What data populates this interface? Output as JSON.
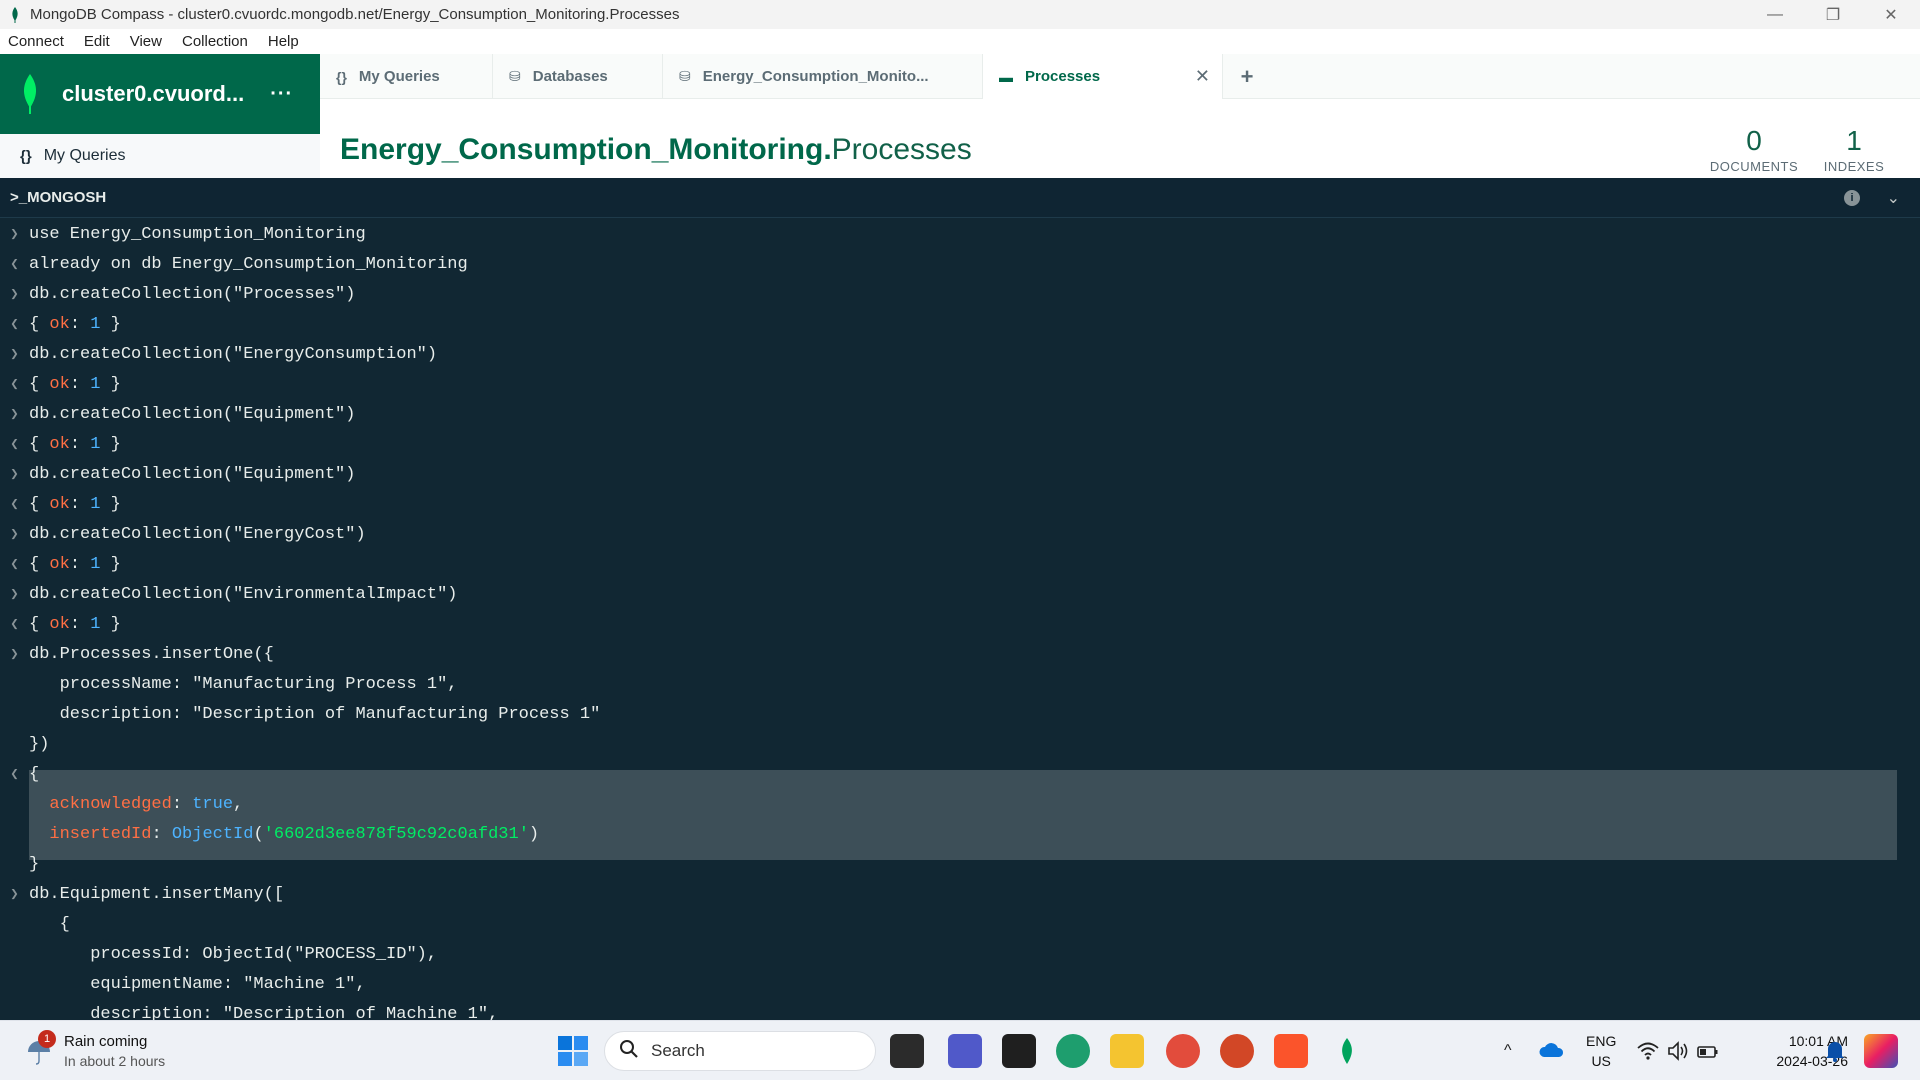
{
  "window": {
    "title": "MongoDB Compass - cluster0.cvuordc.mongodb.net/Energy_Consumption_Monitoring.Processes",
    "minimize": "—",
    "restore": "❐",
    "close": "✕"
  },
  "menu": [
    "Connect",
    "Edit",
    "View",
    "Collection",
    "Help"
  ],
  "sidebar": {
    "cluster_name": "cluster0.cvuord...",
    "more": "···",
    "my_queries": "My Queries",
    "my_queries_icon": "{}"
  },
  "tabs": [
    {
      "label": "My Queries",
      "icon": "{}"
    },
    {
      "label": "Databases",
      "icon": "⛁"
    },
    {
      "label": "Energy_Consumption_Monito...",
      "icon": "⛁"
    },
    {
      "label": "Processes",
      "icon": "▬",
      "close": "✕"
    }
  ],
  "tab_add": "+",
  "collection": {
    "db": "Energy_Consumption_Monitoring.",
    "name": "Processes",
    "documents_count": "0",
    "documents_label": "DOCUMENTS",
    "indexes_count": "1",
    "indexes_label": "INDEXES"
  },
  "shell": {
    "title": ">_MONGOSH",
    "info": "i",
    "chevron": "⌄",
    "lines": [
      {
        "dir": ">",
        "text": "use Energy_Consumption_Monitoring"
      },
      {
        "dir": "<",
        "text": "already on db Energy_Consumption_Monitoring"
      },
      {
        "dir": ">",
        "text": "db.createCollection(\"Processes\")"
      },
      {
        "dir": "<",
        "text": "{ ok: 1 }"
      },
      {
        "dir": ">",
        "text": "db.createCollection(\"EnergyConsumption\")"
      },
      {
        "dir": "<",
        "text": "{ ok: 1 }"
      },
      {
        "dir": ">",
        "text": "db.createCollection(\"Equipment\")"
      },
      {
        "dir": "<",
        "text": "{ ok: 1 }"
      },
      {
        "dir": ">",
        "text": "db.createCollection(\"Equipment\")"
      },
      {
        "dir": "<",
        "text": "{ ok: 1 }"
      },
      {
        "dir": ">",
        "text": "db.createCollection(\"EnergyCost\")"
      },
      {
        "dir": "<",
        "text": "{ ok: 1 }"
      },
      {
        "dir": ">",
        "text": "db.createCollection(\"EnvironmentalImpact\")"
      },
      {
        "dir": "<",
        "text": "{ ok: 1 }"
      },
      {
        "dir": ">",
        "text": "db.Processes.insertOne({"
      },
      {
        "dir": "",
        "text": "   processName: \"Manufacturing Process 1\","
      },
      {
        "dir": "",
        "text": "   description: \"Description of Manufacturing Process 1\""
      },
      {
        "dir": "",
        "text": "})"
      },
      {
        "dir": "<",
        "text": "{"
      },
      {
        "dir": "",
        "text": "  acknowledged: true,"
      },
      {
        "dir": "",
        "text": "  insertedId: ObjectId('6602d3ee878f59c92c0afd31')"
      },
      {
        "dir": "",
        "text": "}"
      },
      {
        "dir": ">",
        "text": "db.Equipment.insertMany(["
      },
      {
        "dir": "",
        "text": "   {"
      },
      {
        "dir": "",
        "text": "      processId: ObjectId(\"PROCESS_ID\"),"
      },
      {
        "dir": "",
        "text": "      equipmentName: \"Machine 1\","
      },
      {
        "dir": "",
        "text": "      description: \"Description of Machine 1\","
      }
    ]
  },
  "taskbar": {
    "weather_title": "Rain coming",
    "weather_sub": "In about 2 hours",
    "weather_badge": "1",
    "search_placeholder": "Search",
    "lang_top": "ENG",
    "lang_bottom": "US",
    "time": "10:01 AM",
    "date": "2024-03-26",
    "tray_chevron": "^"
  }
}
